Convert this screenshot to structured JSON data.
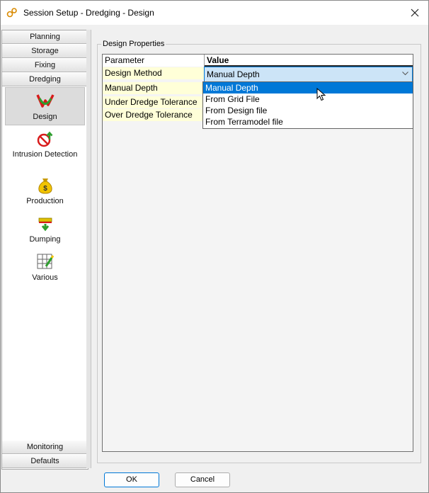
{
  "window": {
    "title": "Session Setup - Dredging -  Design"
  },
  "nav": {
    "sections_top": [
      "Planning",
      "Storage",
      "Fixing",
      "Dredging"
    ],
    "items": [
      {
        "label": "Design",
        "icon": "design-icon",
        "selected": true
      },
      {
        "label": "Intrusion Detection",
        "icon": "intrusion-detection-icon"
      },
      {
        "label": "Production",
        "icon": "production-icon"
      },
      {
        "label": "Dumping",
        "icon": "dumping-icon"
      },
      {
        "label": "Various",
        "icon": "various-icon"
      }
    ],
    "sections_bottom": [
      "Monitoring",
      "Defaults"
    ]
  },
  "group": {
    "title": "Design Properties"
  },
  "grid": {
    "header": {
      "parameter": "Parameter",
      "value": "Value"
    },
    "rows": [
      "Design Method",
      "Manual Depth",
      "Under Dredge Tolerance",
      "Over Dredge Tolerance"
    ],
    "combo_value": "Manual Depth",
    "options": [
      "Manual Depth",
      "From Grid File",
      "From Design file",
      "From Terramodel file"
    ],
    "selected_option_index": 0
  },
  "buttons": {
    "ok": "OK",
    "cancel": "Cancel"
  },
  "colors": {
    "accent": "#0078d7",
    "param_bg": "#ffffd8",
    "combo_bg": "#cce4f7"
  }
}
